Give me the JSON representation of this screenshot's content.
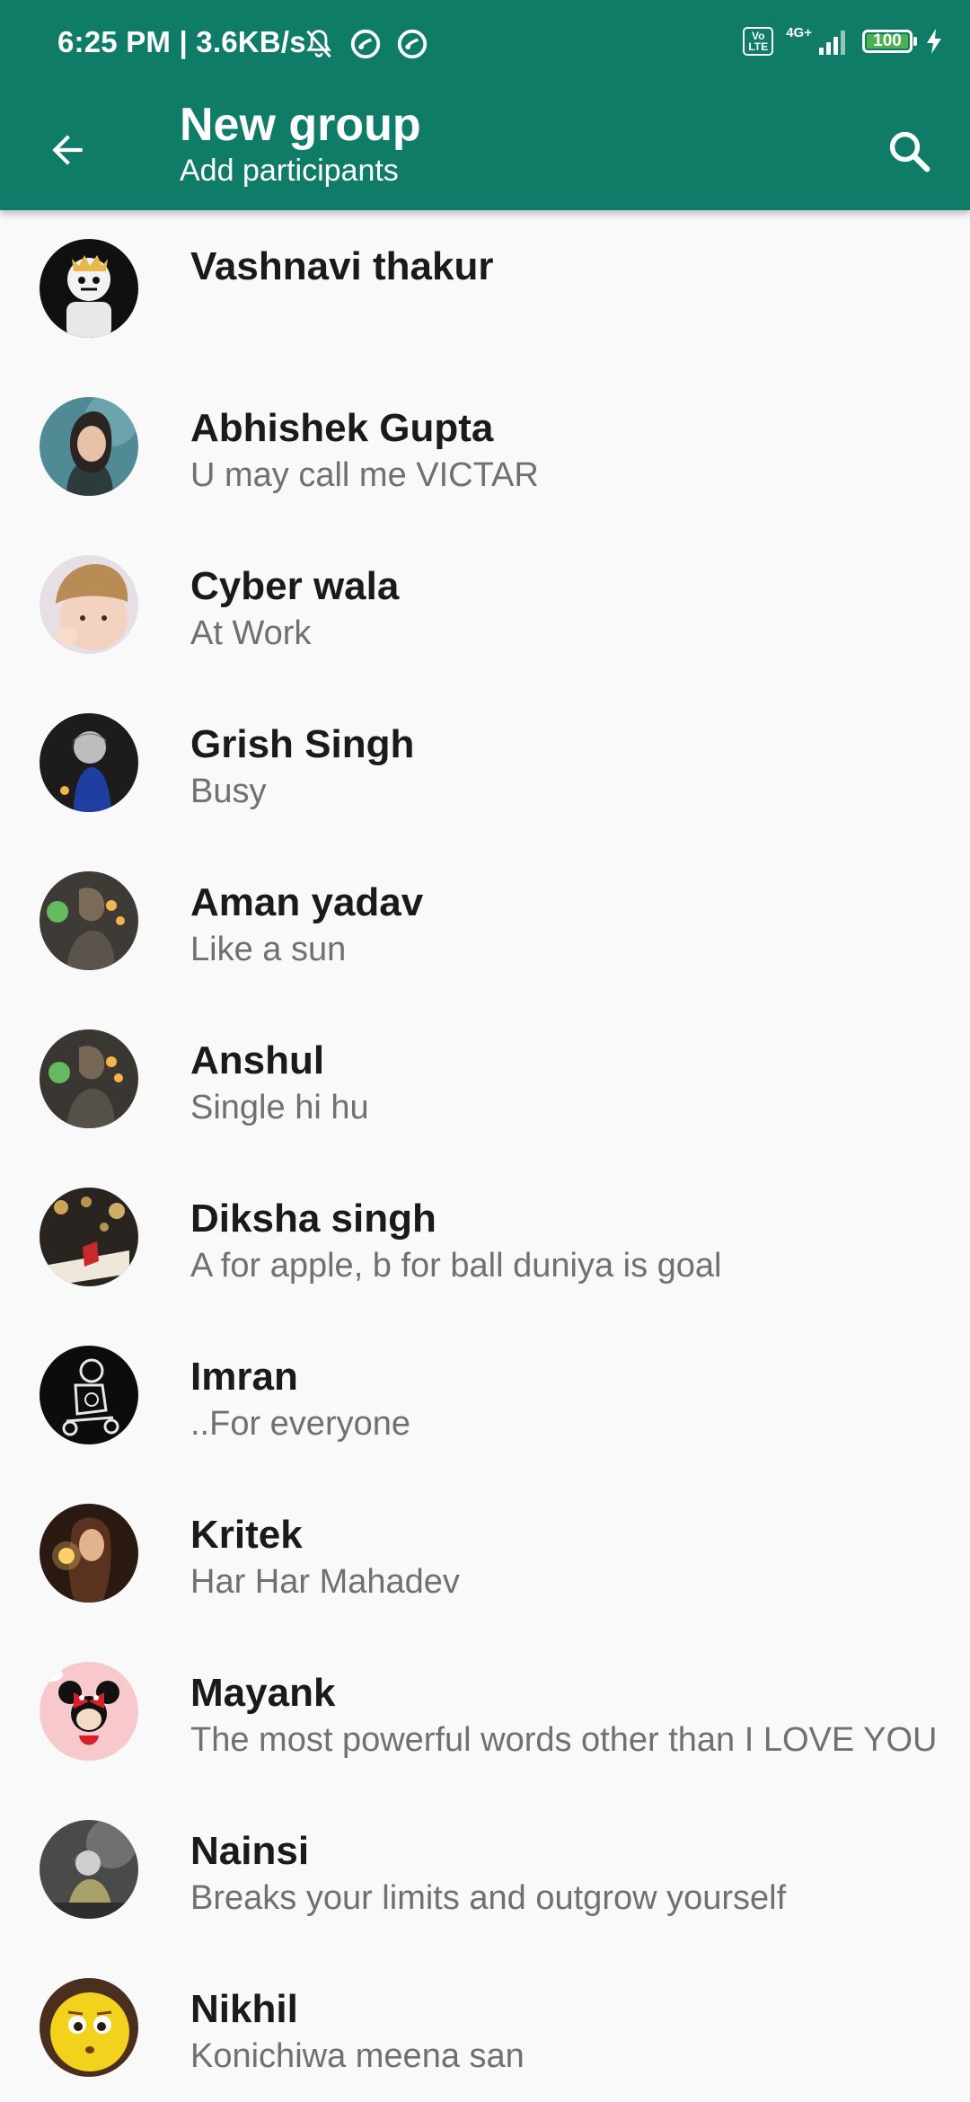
{
  "status_bar": {
    "time": "6:25 PM | 3.6KB/s",
    "volte": "Vo LTE",
    "network": "4G+",
    "battery": "100",
    "battery_level": 100
  },
  "toolbar": {
    "title": "New group",
    "subtitle": "Add participants",
    "back_icon": "arrow-left-icon",
    "search_icon": "search-icon"
  },
  "colors": {
    "app_bar": "#0e7c66",
    "background": "#f9f9f9",
    "name_text": "#1a1a1a",
    "status_text": "#707070"
  },
  "contacts": [
    {
      "name": "Vashnavi thakur",
      "status": ""
    },
    {
      "name": "Abhishek Gupta",
      "status": "U may call me VICTAR"
    },
    {
      "name": "Cyber wala",
      "status": "At Work"
    },
    {
      "name": "Grish Singh",
      "status": "Busy"
    },
    {
      "name": "Aman yadav",
      "status": "Like a sun"
    },
    {
      "name": "Anshul",
      "status": "Single hi hu"
    },
    {
      "name": "Diksha singh",
      "status": "A for apple, b for ball duniya is goal"
    },
    {
      "name": "Imran",
      "status": "..For everyone"
    },
    {
      "name": "Kritek",
      "status": "Har Har Mahadev"
    },
    {
      "name": "Mayank",
      "status": "The most powerful words other than I LOVE YOU"
    },
    {
      "name": "Nainsi",
      "status": "Breaks your limits and outgrow yourself"
    },
    {
      "name": "Nikhil",
      "status": "Konichiwa meena san"
    }
  ]
}
